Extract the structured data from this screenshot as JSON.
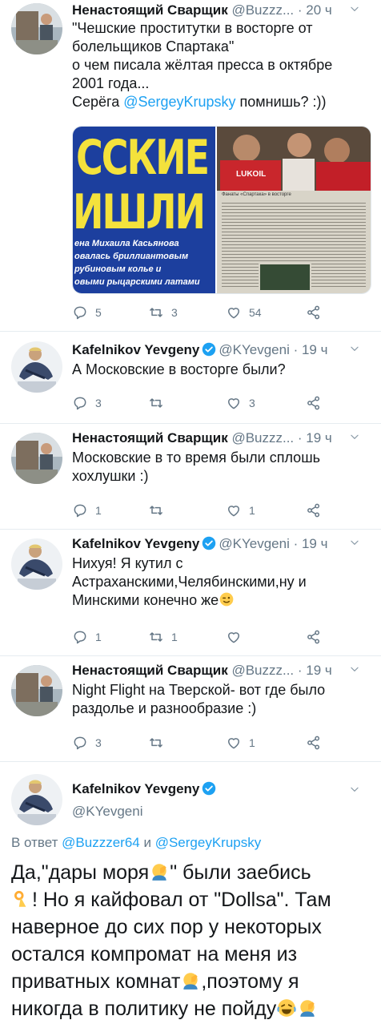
{
  "tweets": [
    {
      "name": "Ненастоящий Сварщик",
      "handle": "@Buzzz...",
      "time": "· 20 ч",
      "lines": [
        "\"Чешские проститутки в восторге от",
        "болельщиков Спартака\"",
        "о чем писала жёлтая пресса в октябре",
        "2001 года..."
      ],
      "mention_prefix": "Серёга ",
      "mention": "@SergeyKrupsky",
      "mention_suffix": " помнишь? :))",
      "media": {
        "left_headline_1": "ССКИЕ",
        "left_headline_2": "ИШЛИ",
        "left_caption_lines": [
          "ена Михаила Касьянова",
          "овалась бриллиантовым",
          "рубиновым колье и",
          "овыми рыцарскими латами"
        ],
        "right_logo": "LUKOIL",
        "right_caption": "Фанаты «Спартака» в восторге"
      },
      "reply_count": "5",
      "retweet_count": "3",
      "like_count": "54"
    },
    {
      "name": "Kafelnikov Yevgeny",
      "handle": "@KYevgeni",
      "time": "· 19 ч",
      "lines": [
        "А Московские в восторге были?"
      ],
      "reply_count": "3",
      "retweet_count": "",
      "like_count": "3"
    },
    {
      "name": "Ненастоящий Сварщик",
      "handle": "@Buzzz...",
      "time": "· 19 ч",
      "lines": [
        "Московские в то время были сплошь",
        "хохлушки :)"
      ],
      "reply_count": "1",
      "retweet_count": "",
      "like_count": "1"
    },
    {
      "name": "Kafelnikov Yevgeny",
      "handle": "@KYevgeni",
      "time": "· 19 ч",
      "lines": [
        "Нихуя! Я кутил с",
        "Астраханскими,Челябинскими,ну и",
        "Минскими конечно же"
      ],
      "reply_count": "1",
      "retweet_count": "1",
      "like_count": ""
    },
    {
      "name": "Ненастоящий Сварщик",
      "handle": "@Buzzz...",
      "time": "· 19 ч",
      "lines": [
        "Night Flight на Тверской- вот где было",
        "раздолье и разнообразие :)"
      ],
      "reply_count": "3",
      "retweet_count": "",
      "like_count": "1"
    }
  ],
  "main_tweet": {
    "name": "Kafelnikov Yevgeny",
    "handle": "@KYevgeni",
    "reply_prefix": "В ответ ",
    "reply_user1": "@Buzzzer64",
    "reply_and": " и ",
    "reply_user2": "@SergeyKrupsky",
    "text_parts": [
      "Да,\"дары моря",
      "\" были заебись",
      "! Но я кайфовал от \"Dollsa\". Там",
      "наверное до сих пор у некоторых",
      "остался компромат на меня из",
      "приватных комнат",
      ",поэтому я",
      "никогда в политику не пойду"
    ]
  },
  "icons": {
    "reply": "reply-icon",
    "retweet": "retweet-icon",
    "like": "heart-icon",
    "share": "share-icon",
    "verified": "verified-badge-icon",
    "more": "chevron-down-icon"
  },
  "colors": {
    "link": "#1da1f2",
    "secondary": "#657786",
    "verified": "#1da1f2"
  }
}
